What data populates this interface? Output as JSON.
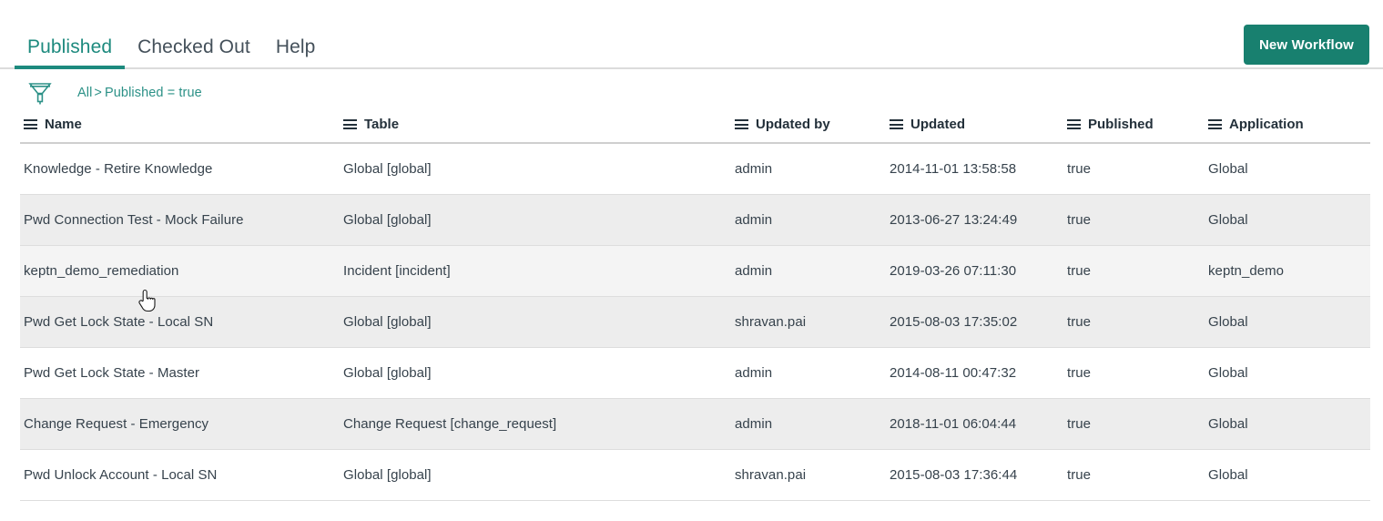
{
  "header": {
    "tabs": [
      {
        "label": "Published",
        "active": true,
        "name": "tab-published"
      },
      {
        "label": "Checked Out",
        "active": false,
        "name": "tab-checked-out"
      },
      {
        "label": "Help",
        "active": false,
        "name": "tab-help"
      }
    ],
    "new_workflow_label": "New Workflow"
  },
  "filter": {
    "icon": "funnel-icon",
    "breadcrumb_root": "All",
    "breadcrumb_separator": ">",
    "breadcrumb_condition": "Published = true"
  },
  "table": {
    "columns": [
      {
        "label": "Name",
        "icon": "hamburger-icon",
        "cls": "col-name",
        "key": "name"
      },
      {
        "label": "Table",
        "icon": "hamburger-icon",
        "cls": "col-table",
        "key": "table"
      },
      {
        "label": "Updated by",
        "icon": "hamburger-icon",
        "cls": "col-updatedby",
        "key": "updated_by"
      },
      {
        "label": "Updated",
        "icon": "hamburger-icon",
        "cls": "col-updated",
        "key": "updated"
      },
      {
        "label": "Published",
        "icon": "hamburger-icon",
        "cls": "col-published",
        "key": "published"
      },
      {
        "label": "Application",
        "icon": "hamburger-icon",
        "cls": "col-application",
        "key": "application"
      }
    ],
    "rows": [
      {
        "name": "Knowledge - Retire Knowledge",
        "table": "Global [global]",
        "updated_by": "admin",
        "updated": "2014-11-01 13:58:58",
        "published": "true",
        "application": "Global",
        "shade": "odd"
      },
      {
        "name": "Pwd Connection Test - Mock Failure",
        "table": "Global [global]",
        "updated_by": "admin",
        "updated": "2013-06-27 13:24:49",
        "published": "true",
        "application": "Global",
        "shade": "even"
      },
      {
        "name": "keptn_demo_remediation",
        "table": "Incident [incident]",
        "updated_by": "admin",
        "updated": "2019-03-26 07:11:30",
        "published": "true",
        "application": "keptn_demo",
        "shade": "hover"
      },
      {
        "name": "Pwd Get Lock State - Local SN",
        "table": "Global [global]",
        "updated_by": "shravan.pai",
        "updated": "2015-08-03 17:35:02",
        "published": "true",
        "application": "Global",
        "shade": "even"
      },
      {
        "name": "Pwd Get Lock State - Master",
        "table": "Global [global]",
        "updated_by": "admin",
        "updated": "2014-08-11 00:47:32",
        "published": "true",
        "application": "Global",
        "shade": "odd"
      },
      {
        "name": "Change Request - Emergency",
        "table": "Change Request [change_request]",
        "updated_by": "admin",
        "updated": "2018-11-01 06:04:44",
        "published": "true",
        "application": "Global",
        "shade": "even"
      },
      {
        "name": "Pwd Unlock Account - Local SN",
        "table": "Global [global]",
        "updated_by": "shravan.pai",
        "updated": "2015-08-03 17:36:44",
        "published": "true",
        "application": "Global",
        "shade": "odd"
      }
    ]
  },
  "colors": {
    "accent_teal": "#1d8a7e",
    "button_green": "#18806f",
    "link_teal": "#2c9187",
    "row_stripe": "#ededed",
    "row_hover": "#f4f4f4",
    "text": "#36424c"
  },
  "cursor": {
    "type": "pointer-hand-cursor"
  }
}
